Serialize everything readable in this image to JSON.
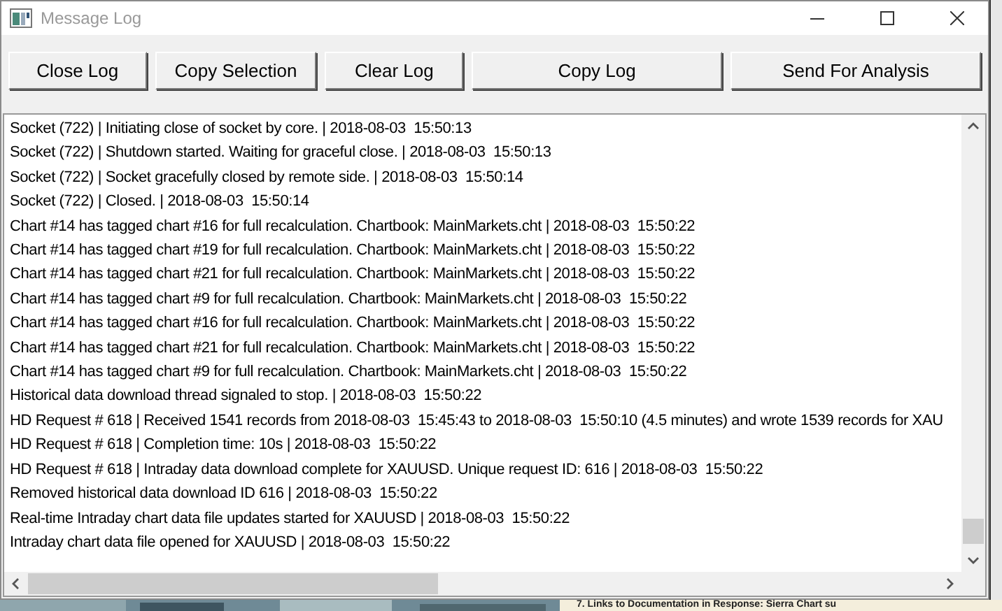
{
  "window": {
    "title": "Message Log"
  },
  "buttons": [
    {
      "label": "Close Log"
    },
    {
      "label": "Copy Selection"
    },
    {
      "label": "Clear Log"
    },
    {
      "label": "Copy Log"
    },
    {
      "label": "Send For Analysis"
    }
  ],
  "log": {
    "lines": [
      "Socket (722) | Initiating close of socket by core. | 2018-08-03  15:50:13",
      "Socket (722) | Shutdown started. Waiting for graceful close. | 2018-08-03  15:50:13",
      "Socket (722) | Socket gracefully closed by remote side. | 2018-08-03  15:50:14",
      "Socket (722) | Closed. | 2018-08-03  15:50:14",
      "Chart #14 has tagged chart #16 for full recalculation. Chartbook: MainMarkets.cht | 2018-08-03  15:50:22",
      "Chart #14 has tagged chart #19 for full recalculation. Chartbook: MainMarkets.cht | 2018-08-03  15:50:22",
      "Chart #14 has tagged chart #21 for full recalculation. Chartbook: MainMarkets.cht | 2018-08-03  15:50:22",
      "Chart #14 has tagged chart #9 for full recalculation. Chartbook: MainMarkets.cht | 2018-08-03  15:50:22",
      "Chart #14 has tagged chart #16 for full recalculation. Chartbook: MainMarkets.cht | 2018-08-03  15:50:22",
      "Chart #14 has tagged chart #21 for full recalculation. Chartbook: MainMarkets.cht | 2018-08-03  15:50:22",
      "Chart #14 has tagged chart #9 for full recalculation. Chartbook: MainMarkets.cht | 2018-08-03  15:50:22",
      "Historical data download thread signaled to stop. | 2018-08-03  15:50:22",
      "HD Request # 618 | Received 1541 records from 2018-08-03  15:45:43 to 2018-08-03  15:50:10 (4.5 minutes) and wrote 1539 records for XAU",
      "HD Request # 618 | Completion time: 10s | 2018-08-03  15:50:22",
      "HD Request # 618 | Intraday data download complete for XAUUSD. Unique request ID: 616 | 2018-08-03  15:50:22",
      "Removed historical data download ID 616 | 2018-08-03  15:50:22",
      "Real-time Intraday chart data file updates started for XAUUSD | 2018-08-03  15:50:22",
      "Intraday chart data file opened for XAUUSD | 2018-08-03  15:50:22"
    ]
  },
  "background": {
    "text": "7. Links to Documentation in Response: Sierra Chart su"
  }
}
